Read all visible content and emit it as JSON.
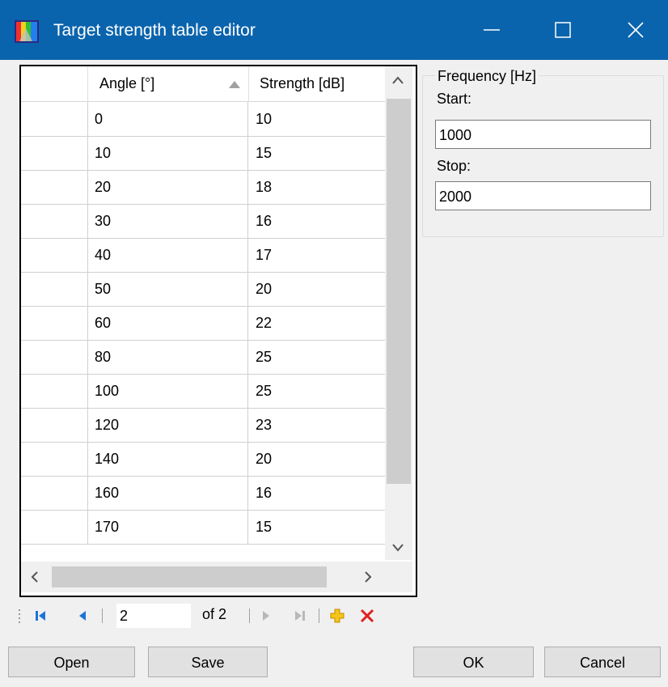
{
  "window": {
    "title": "Target strength table editor",
    "accent": "#0a64ad"
  },
  "grid": {
    "columns": [
      "Angle [°]",
      "Strength [dB]"
    ],
    "rows": [
      {
        "angle": "0",
        "strength": "10"
      },
      {
        "angle": "10",
        "strength": "15"
      },
      {
        "angle": "20",
        "strength": "18"
      },
      {
        "angle": "30",
        "strength": "16"
      },
      {
        "angle": "40",
        "strength": "17"
      },
      {
        "angle": "50",
        "strength": "20"
      },
      {
        "angle": "60",
        "strength": "22"
      },
      {
        "angle": "80",
        "strength": "25"
      },
      {
        "angle": "100",
        "strength": "25"
      },
      {
        "angle": "120",
        "strength": "23"
      },
      {
        "angle": "140",
        "strength": "20"
      },
      {
        "angle": "160",
        "strength": "16"
      },
      {
        "angle": "170",
        "strength": "15"
      }
    ]
  },
  "frequency": {
    "group_label": "Frequency [Hz]",
    "start_label": "Start:",
    "start_value": "1000",
    "stop_label": "Stop:",
    "stop_value": "2000"
  },
  "navigator": {
    "position": "2",
    "of_label": "of 2"
  },
  "buttons": {
    "open": "Open",
    "save": "Save",
    "ok": "OK",
    "cancel": "Cancel"
  }
}
